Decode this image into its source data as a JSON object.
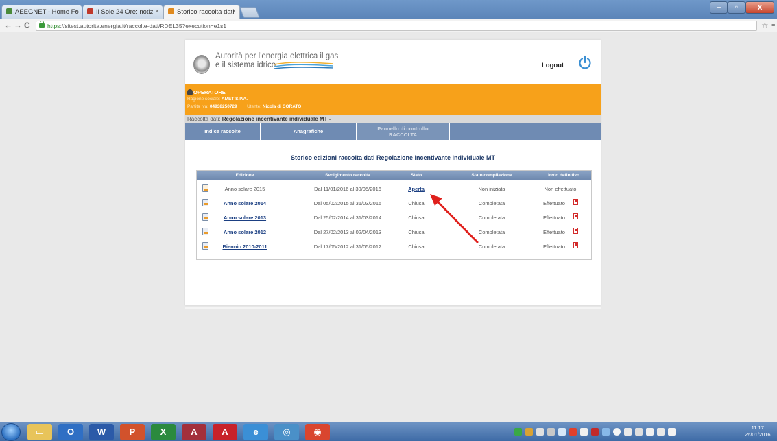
{
  "browser": {
    "tabs": [
      {
        "title": "AEEGNET - Home Fo",
        "favicon_color": "#4a8a3a",
        "active": false
      },
      {
        "title": "Il Sole 24 Ore: notiz",
        "favicon_color": "#c0392b",
        "active": false
      },
      {
        "title": "Storico raccolta dati",
        "favicon_color": "#e08a1e",
        "active": true
      }
    ],
    "url_scheme": "https",
    "url_rest": "://sitest.autorita.energia.it/raccolte-dati/RDEL35?execution=e1s1",
    "close_glyph": "×"
  },
  "header": {
    "logo_line1": "Autorità per l'energia elettrica il gas",
    "logo_line2": "e il sistema idrico",
    "logout_label": "Logout"
  },
  "operator": {
    "title": "OPERATORE",
    "ragione_label": "Ragione sociale:",
    "ragione_value": "AMET S.P.A.",
    "piva_label": "Partita Iva:",
    "piva_value": "04938250729",
    "utente_label": "Utente:",
    "utente_value": "Nicola di CORATO"
  },
  "breadcrumb": {
    "label": "Raccolta dati:",
    "value": "Regolazione incentivante individuale MT -"
  },
  "nav_tabs": [
    {
      "label": "Indice raccolte"
    },
    {
      "label": "Anagrafiche"
    },
    {
      "label_line1": "Pannello di controllo",
      "label_line2": "RACCOLTA"
    }
  ],
  "page_title": "Storico edizioni raccolta dati Regolazione incentivante individuale MT",
  "table": {
    "headers": [
      "Edizione",
      "Svolgimento raccolta",
      "Stato",
      "Stato compilazione",
      "Invio definitivo"
    ],
    "rows": [
      {
        "edizione": "Anno solare 2015",
        "svolgimento": "Dal 11/01/2016 al 30/05/2016",
        "stato": "Aperta",
        "compilazione": "Non iniziata",
        "invio": "Non effettuato",
        "edizione_link": false,
        "stato_link": true,
        "pdf": false
      },
      {
        "edizione": "Anno solare 2014",
        "svolgimento": "Dal 05/02/2015 al 31/03/2015",
        "stato": "Chiusa",
        "compilazione": "Completata",
        "invio": "Effettuato",
        "edizione_link": true,
        "stato_link": false,
        "pdf": true
      },
      {
        "edizione": "Anno solare 2013",
        "svolgimento": "Dal 25/02/2014 al 31/03/2014",
        "stato": "Chiusa",
        "compilazione": "Completata",
        "invio": "Effettuato",
        "edizione_link": true,
        "stato_link": false,
        "pdf": true
      },
      {
        "edizione": "Anno solare 2012",
        "svolgimento": "Dal 27/02/2013 al 02/04/2013",
        "stato": "Chiusa",
        "compilazione": "Completata",
        "invio": "Effettuato",
        "edizione_link": true,
        "stato_link": false,
        "pdf": true
      },
      {
        "edizione": "Biennio 2010-2011",
        "svolgimento": "Dal 17/05/2012 al 31/05/2012",
        "stato": "Chiusa",
        "compilazione": "Completata",
        "invio": "Effettuato",
        "edizione_link": true,
        "stato_link": false,
        "pdf": true
      }
    ]
  },
  "taskbar": {
    "clock_time": "11:17",
    "clock_date": "26/01/2016",
    "apps": [
      {
        "name": "explorer",
        "glyph": "▭",
        "color": "#e8c45a"
      },
      {
        "name": "outlook",
        "glyph": "O",
        "color": "#2f6fc4"
      },
      {
        "name": "word",
        "glyph": "W",
        "color": "#2b5aa8"
      },
      {
        "name": "powerpoint",
        "glyph": "P",
        "color": "#d2522c"
      },
      {
        "name": "excel",
        "glyph": "X",
        "color": "#2b8a3e"
      },
      {
        "name": "access",
        "glyph": "A",
        "color": "#a3303b"
      },
      {
        "name": "acrobat",
        "glyph": "A",
        "color": "#c8222a"
      },
      {
        "name": "internet-explorer",
        "glyph": "e",
        "color": "#3b8fd6"
      },
      {
        "name": "app-circle",
        "glyph": "◎",
        "color": "#4a90c8"
      },
      {
        "name": "chrome",
        "glyph": "◉",
        "color": "#d9452f"
      }
    ]
  },
  "colors": {
    "operator_band": "#f7a11a",
    "nav_blue": "#6f8bb3",
    "title_blue": "#1f3a68",
    "arrow_red": "#e0201c"
  }
}
